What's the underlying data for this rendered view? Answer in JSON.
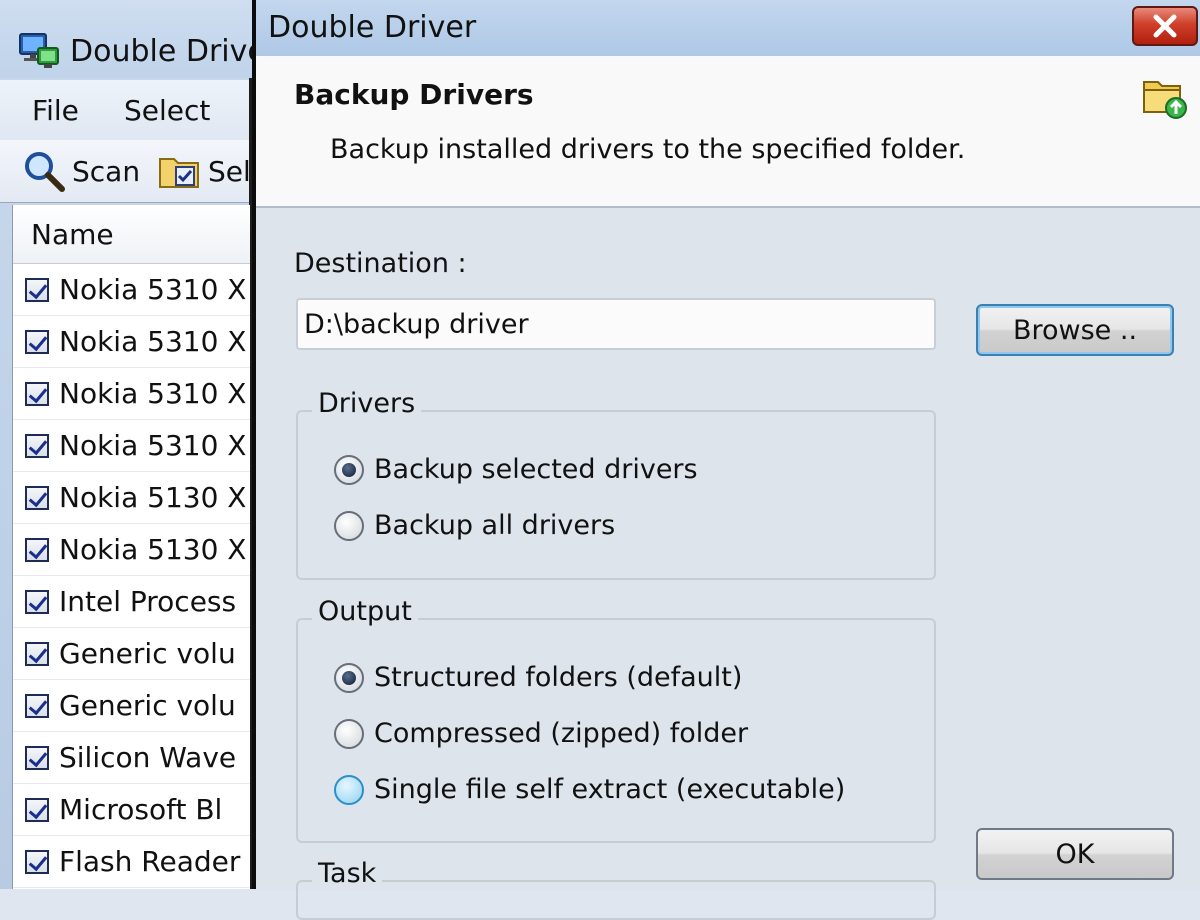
{
  "main_window": {
    "title": "Double Drive",
    "menu": [
      {
        "label": "File"
      },
      {
        "label": "Select"
      }
    ],
    "toolbar": {
      "scan_label": "Scan",
      "select_label": "Sel"
    },
    "list": {
      "column_header": "Name",
      "rows": [
        "Nokia 5310 X",
        "Nokia 5310 X",
        "Nokia 5310 X",
        "Nokia 5310 X",
        "Nokia 5130 X",
        "Nokia 5130 X",
        "Intel Process",
        "Generic volu",
        "Generic volu",
        "Silicon Wave",
        "Microsoft Bl",
        "Flash Reader"
      ]
    }
  },
  "dialog": {
    "title": "Double Driver",
    "header": {
      "title": "Backup Drivers",
      "description": "Backup installed drivers to the specified folder."
    },
    "destination": {
      "label": "Destination :",
      "value": "D:\\backup driver",
      "browse_label": "Browse .."
    },
    "drivers_group": {
      "label": "Drivers",
      "options": [
        "Backup selected drivers",
        "Backup all drivers"
      ],
      "selected": 0
    },
    "output_group": {
      "label": "Output",
      "options": [
        "Structured folders (default)",
        "Compressed (zipped) folder",
        "Single file self extract (executable)"
      ],
      "selected": 0,
      "hovered": 2
    },
    "task_group": {
      "label": "Task"
    },
    "ok_label": "OK"
  },
  "colors": {
    "close_button": "#cf3f2a",
    "focus_border": "#3c7fb1"
  }
}
